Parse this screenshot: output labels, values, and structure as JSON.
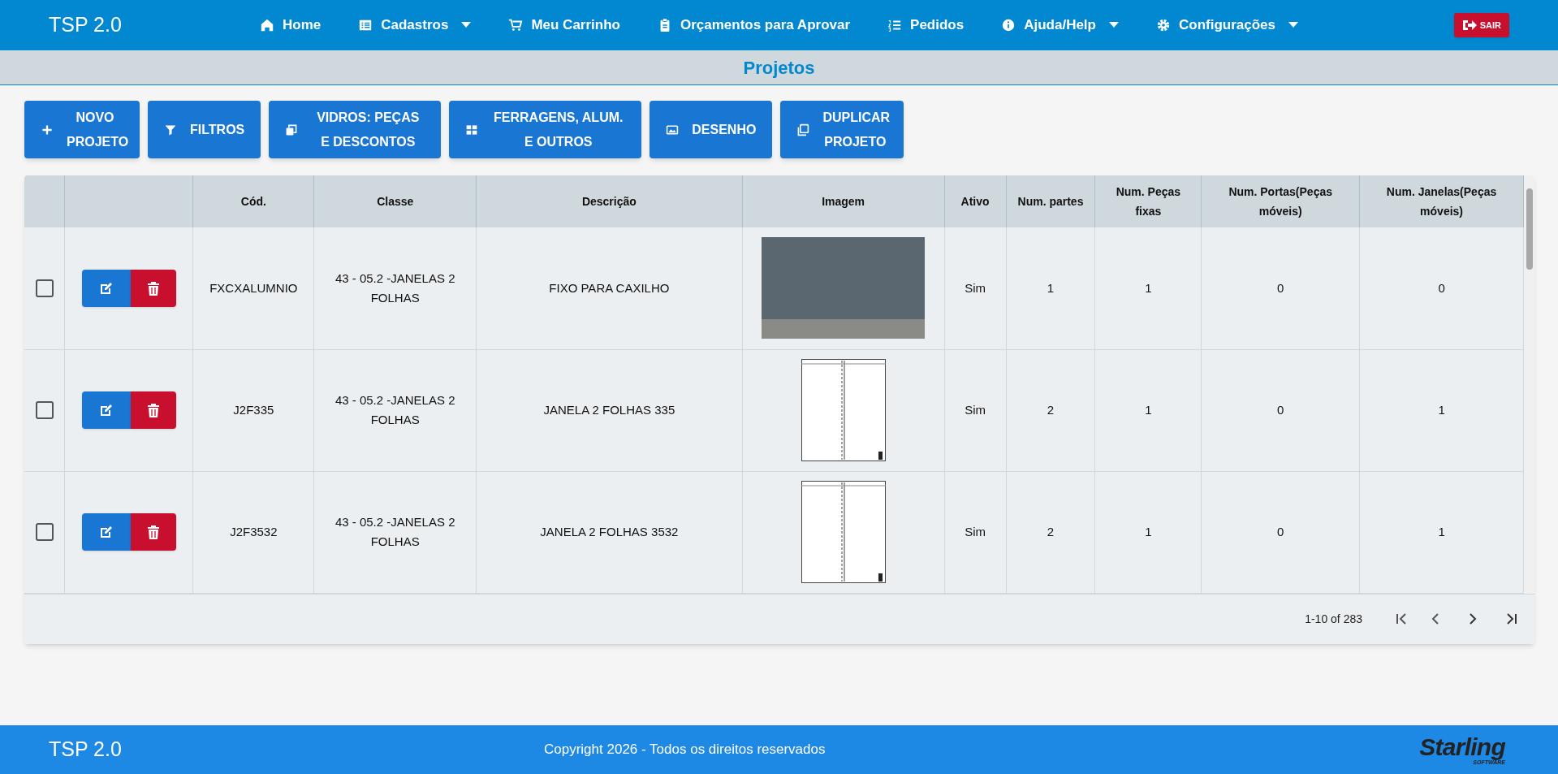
{
  "nav": {
    "brand": "TSP 2.0",
    "items": [
      {
        "label": "Home",
        "dropdown": false
      },
      {
        "label": "Cadastros",
        "dropdown": true
      },
      {
        "label": "Meu Carrinho",
        "dropdown": false
      },
      {
        "label": "Orçamentos para Aprovar",
        "dropdown": false
      },
      {
        "label": "Pedidos",
        "dropdown": false
      },
      {
        "label": "Ajuda/Help",
        "dropdown": true
      },
      {
        "label": "Configurações",
        "dropdown": true
      }
    ],
    "logout": "SAIR"
  },
  "page_title": "Projetos",
  "toolbar": [
    "NOVO PROJETO",
    "FILTROS",
    "VIDROS: PEÇAS E DESCONTOS",
    "FERRAGENS, ALUM. E OUTROS",
    "DESENHO",
    "DUPLICAR PROJETO"
  ],
  "table": {
    "columns": [
      "Cód.",
      "Classe",
      "Descrição",
      "Imagem",
      "Ativo",
      "Num. partes",
      "Num. Peças fixas",
      "Num. Portas(Peças móveis)",
      "Num. Janelas(Peças móveis)"
    ],
    "rows": [
      {
        "checked": false,
        "code": "FXCXALUMNIO",
        "class": "43 - 05.2 -JANELAS 2 FOLHAS",
        "description": "FIXO PARA CAXILHO",
        "kind": "photo",
        "active": "Sim",
        "parts": "1",
        "fixed": "1",
        "doors": "0",
        "windows": "0"
      },
      {
        "checked": false,
        "code": "J2F335",
        "class": "43 - 05.2 -JANELAS 2 FOLHAS",
        "description": "JANELA 2 FOLHAS 335",
        "kind": "drawing",
        "active": "Sim",
        "parts": "2",
        "fixed": "1",
        "doors": "0",
        "windows": "1"
      },
      {
        "checked": false,
        "code": "J2F3532",
        "class": "43 - 05.2 -JANELAS 2 FOLHAS",
        "description": "JANELA 2 FOLHAS 3532",
        "kind": "drawing",
        "active": "Sim",
        "parts": "2",
        "fixed": "1",
        "doors": "0",
        "windows": "1"
      }
    ],
    "pagination": "1-10 of 283"
  },
  "footer": {
    "brand": "TSP 2.0",
    "copyright": "Copyright 2026 - Todos os direitos reservados",
    "logo": "Starling",
    "logo_sub": "SOFTWARE"
  }
}
